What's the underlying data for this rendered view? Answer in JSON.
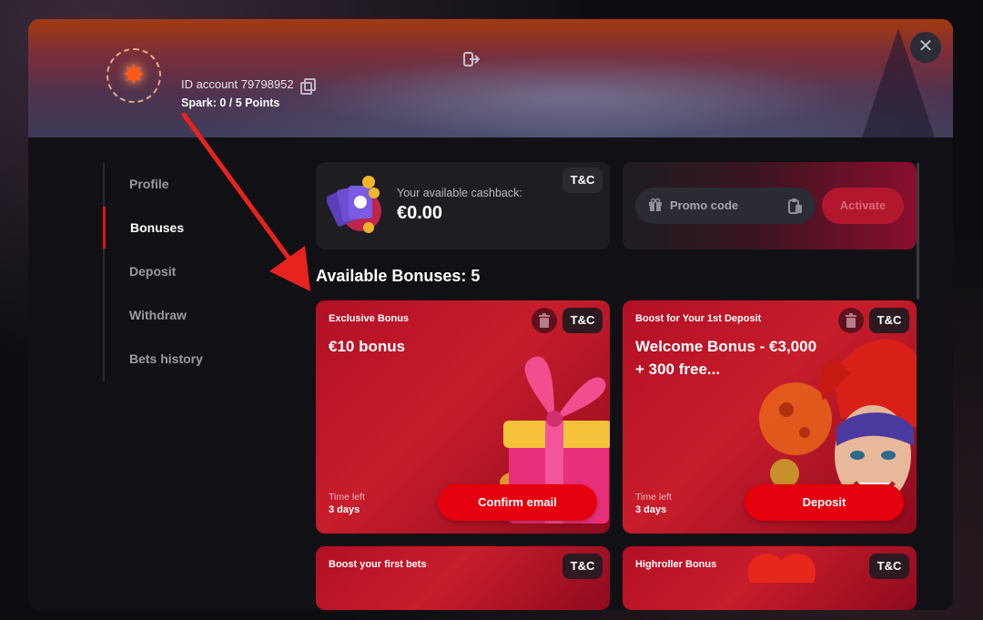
{
  "header": {
    "account_id": "ID account 79798952",
    "spark_points": "Spark: 0  / 5 Points"
  },
  "sidebar": {
    "items": [
      {
        "label": "Profile"
      },
      {
        "label": "Bonuses",
        "active": true
      },
      {
        "label": "Deposit"
      },
      {
        "label": "Withdraw"
      },
      {
        "label": "Bets history"
      }
    ]
  },
  "cashback": {
    "label": "Your available cashback:",
    "value": "€0.00",
    "tnc": "T&C"
  },
  "promo": {
    "placeholder": "Promo code",
    "activate_label": "Activate"
  },
  "bonuses": {
    "title": "Available Bonuses: 5",
    "cards": [
      {
        "tag": "Exclusive Bonus",
        "title": "€10 bonus",
        "tnc": "T&C",
        "time_label": "Time left",
        "time_value": "3 days",
        "button": "Confirm email"
      },
      {
        "tag": "Boost for Your 1st Deposit",
        "title": "Welcome Bonus - €3,000 + 300 free...",
        "tnc": "T&C",
        "time_label": "Time left",
        "time_value": "3 days",
        "button": "Deposit"
      },
      {
        "tag": "Boost your first bets",
        "tnc": "T&C"
      },
      {
        "tag": "Highroller Bonus",
        "tnc": "T&C"
      }
    ]
  },
  "colors": {
    "accent_red": "#e5000d",
    "card_red": "#c81d2b",
    "modal_bg": "#111115",
    "annotation_arrow": "#e8231f"
  }
}
